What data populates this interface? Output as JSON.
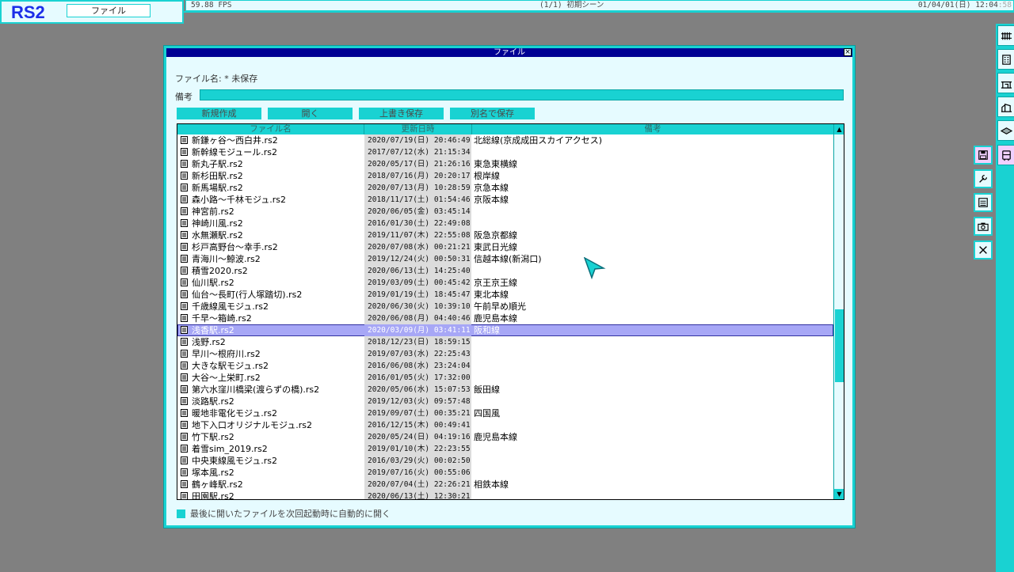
{
  "app": {
    "logo": "RS2",
    "file_menu_label": "ファイル"
  },
  "status": {
    "fps": "59.88 FPS",
    "scene": "(1/1) 初期シーン",
    "clock": "01/04/01(日) 12:04",
    "clock_tail": ":58"
  },
  "dialog": {
    "title": "ファイル",
    "close_label": "×",
    "filename_label": "ファイル名: * 未保存",
    "memo_label": "備考",
    "memo_value": "",
    "buttons": {
      "new": "新規作成",
      "open": "開く",
      "overwrite": "上書き保存",
      "save_as": "別名で保存"
    },
    "columns": {
      "name": "ファイル名",
      "date": "更新日時",
      "memo": "備考"
    },
    "files": [
      {
        "name": "新鎌ヶ谷～西白井.rs2",
        "date": "2020/07/19(日) 20:46:49",
        "memo": "北総線(京成成田スカイアクセス)"
      },
      {
        "name": "新幹線モジュール.rs2",
        "date": "2017/07/12(水) 21:15:34",
        "memo": ""
      },
      {
        "name": "新丸子駅.rs2",
        "date": "2020/05/17(日) 21:26:16",
        "memo": "東急東横線"
      },
      {
        "name": "新杉田駅.rs2",
        "date": "2018/07/16(月) 20:20:17",
        "memo": "根岸線"
      },
      {
        "name": "新馬場駅.rs2",
        "date": "2020/07/13(月) 10:28:59",
        "memo": "京急本線"
      },
      {
        "name": "森小路～千林モジュ.rs2",
        "date": "2018/11/17(土) 01:54:46",
        "memo": "京阪本線"
      },
      {
        "name": "神宮前.rs2",
        "date": "2020/06/05(金) 03:45:14",
        "memo": ""
      },
      {
        "name": "神崎川風.rs2",
        "date": "2016/01/30(土) 22:49:08",
        "memo": ""
      },
      {
        "name": "水無瀬駅.rs2",
        "date": "2019/11/07(木) 22:55:08",
        "memo": "阪急京都線"
      },
      {
        "name": "杉戸高野台～幸手.rs2",
        "date": "2020/07/08(水) 00:21:21",
        "memo": "東武日光線"
      },
      {
        "name": "青海川～鯨波.rs2",
        "date": "2019/12/24(火) 00:50:31",
        "memo": "信越本線(新潟口)"
      },
      {
        "name": "積雪2020.rs2",
        "date": "2020/06/13(土) 14:25:40",
        "memo": ""
      },
      {
        "name": "仙川駅.rs2",
        "date": "2019/03/09(土) 00:45:42",
        "memo": "京王京王線"
      },
      {
        "name": "仙台～長町(行人塚踏切).rs2",
        "date": "2019/01/19(土) 18:45:47",
        "memo": "東北本線"
      },
      {
        "name": "千歳線風モジュ.rs2",
        "date": "2020/06/30(火) 10:39:10",
        "memo": "午前早め順光"
      },
      {
        "name": "千早～箱崎.rs2",
        "date": "2020/06/08(月) 04:40:46",
        "memo": "鹿児島本線"
      },
      {
        "name": "浅香駅.rs2",
        "date": "2020/03/09(月) 03:41:11",
        "memo": "阪和線",
        "selected": true
      },
      {
        "name": "浅野.rs2",
        "date": "2018/12/23(日) 18:59:15",
        "memo": ""
      },
      {
        "name": "早川～根府川.rs2",
        "date": "2019/07/03(水) 22:25:43",
        "memo": ""
      },
      {
        "name": "大きな駅モジュ.rs2",
        "date": "2016/06/08(水) 23:24:04",
        "memo": ""
      },
      {
        "name": "大谷～上栄町.rs2",
        "date": "2016/01/05(火) 17:32:00",
        "memo": ""
      },
      {
        "name": "第六水窪川橋梁(渡らずの橋).rs2",
        "date": "2020/05/06(水) 15:07:53",
        "memo": "飯田線"
      },
      {
        "name": "淡路駅.rs2",
        "date": "2019/12/03(火) 09:57:48",
        "memo": ""
      },
      {
        "name": "暖地非電化モジュ.rs2",
        "date": "2019/09/07(土) 00:35:21",
        "memo": "四国風"
      },
      {
        "name": "地下入口オリジナルモジュ.rs2",
        "date": "2016/12/15(木) 00:49:41",
        "memo": ""
      },
      {
        "name": "竹下駅.rs2",
        "date": "2020/05/24(日) 04:19:16",
        "memo": "鹿児島本線"
      },
      {
        "name": "着雪sim_2019.rs2",
        "date": "2019/01/10(木) 22:23:55",
        "memo": ""
      },
      {
        "name": "中央東線風モジュ.rs2",
        "date": "2016/03/29(火) 00:02:50",
        "memo": ""
      },
      {
        "name": "塚本風.rs2",
        "date": "2019/07/16(火) 00:55:06",
        "memo": ""
      },
      {
        "name": "鶴ヶ峰駅.rs2",
        "date": "2020/07/04(土) 22:26:21",
        "memo": "相鉄本線"
      },
      {
        "name": "田園駅.rs2",
        "date": "2020/06/13(土) 12:30:21",
        "memo": ""
      }
    ],
    "auto_open_label": "最後に開いたファイルを次回起動時に自動的に開く"
  },
  "icons": {
    "right_toolbar": [
      "rail-track-icon",
      "building-icon",
      "station-icon",
      "scenery-icon",
      "layers-icon",
      "train-icon"
    ],
    "side": [
      "save-icon",
      "wrench-icon",
      "list-icon",
      "camera-icon",
      "close-icon"
    ]
  },
  "colors": {
    "accent": "#19d2d2",
    "panel": "#e6fbff",
    "title": "#000094",
    "selected": "#a7a7f6",
    "logo": "#1c2ee8"
  }
}
